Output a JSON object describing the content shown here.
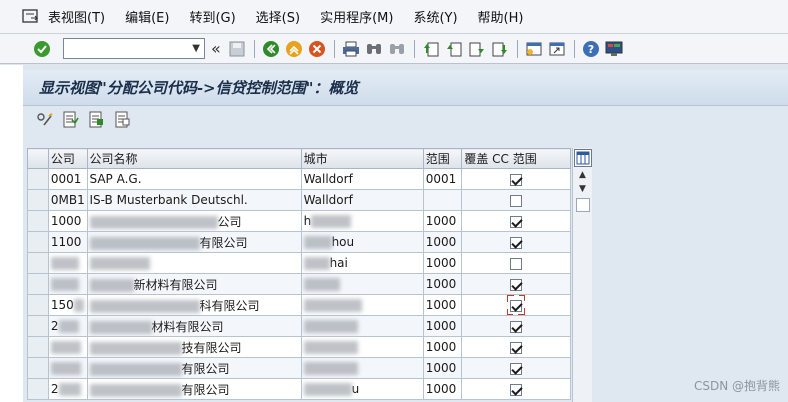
{
  "menu": {
    "items": [
      "表视图(T)",
      "编辑(E)",
      "转到(G)",
      "选择(S)",
      "实用程序(M)",
      "系统(Y)",
      "帮助(H)"
    ]
  },
  "toolbar": {
    "command_value": "",
    "icons": [
      "enter-icon",
      "back-icon",
      "exit-icon",
      "cancel-icon",
      "print-icon",
      "find-icon",
      "find-next-icon",
      "first-page-icon",
      "prev-page-icon",
      "next-page-icon",
      "last-page-icon",
      "new-session-icon",
      "shortcut-icon",
      "help-icon",
      "layout-icon"
    ]
  },
  "title": "显示视图\"分配公司代码->信贷控制范围\"：概览",
  "table": {
    "columns": [
      "公司",
      "公司名称",
      "城市",
      "范围",
      "覆盖 CC 范围"
    ],
    "rows": [
      {
        "code": "0001",
        "name": "SAP A.G.",
        "city": "Walldorf",
        "area": "0001",
        "override": true
      },
      {
        "code": "0MB1",
        "name": "IS-B Musterbank Deutschl.",
        "city": "Walldorf",
        "area": "",
        "override": false
      },
      {
        "code": "1000",
        "name": "公司",
        "city": "h",
        "area": "1000",
        "override": true
      },
      {
        "code": "1100",
        "name": "有限公司",
        "city": "hou",
        "area": "1000",
        "override": true
      },
      {
        "code": "",
        "name": "",
        "city": "hai",
        "area": "1000",
        "override": false
      },
      {
        "code": "",
        "name": "新材料有限公司",
        "city": "",
        "area": "1000",
        "override": true
      },
      {
        "code": "150",
        "name": "科有限公司",
        "city": "",
        "area": "1000",
        "override": true
      },
      {
        "code": "2",
        "name": "材料有限公司",
        "city": "",
        "area": "1000",
        "override": true
      },
      {
        "code": "",
        "name": "技有限公司",
        "city": "",
        "area": "1000",
        "override": true
      },
      {
        "code": "",
        "name": "有限公司",
        "city": "",
        "area": "1000",
        "override": true
      },
      {
        "code": "2",
        "name": "有限公司",
        "city": "u",
        "area": "1000",
        "override": true
      }
    ]
  },
  "watermark": "CSDN @抱背熊"
}
